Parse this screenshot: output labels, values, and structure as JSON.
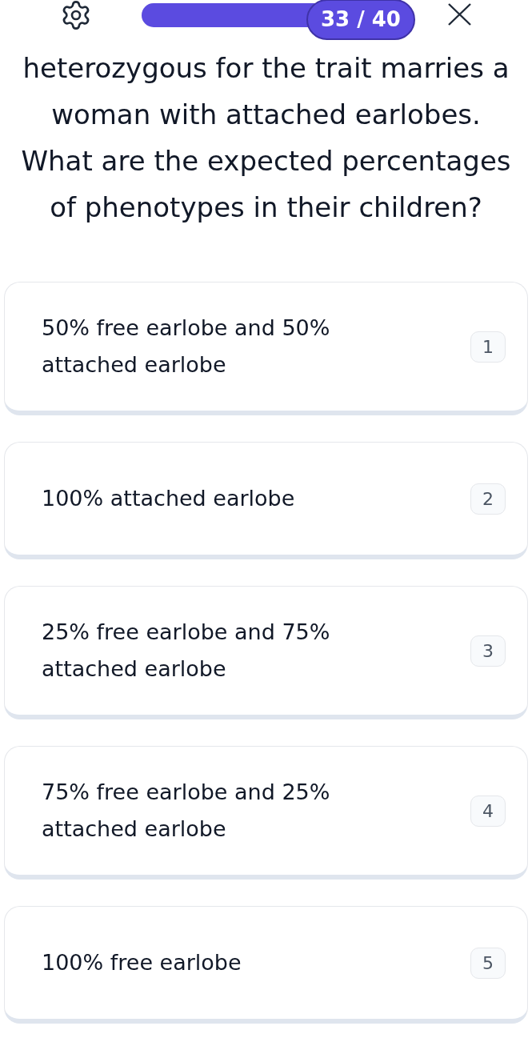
{
  "top_bar": {
    "progress": {
      "level": 0.825,
      "label": "33 / 40"
    }
  },
  "question": "heterozygous for the trait marries a woman with attached earlobes. What are the expected percentages of phenotypes in their children?",
  "options": [
    {
      "text": "50% free earlobe and 50% attached earlobe",
      "key": "1"
    },
    {
      "text": "100% attached earlobe",
      "key": "2"
    },
    {
      "text": "25% free earlobe and 75% attached earlobe",
      "key": "3"
    },
    {
      "text": "75% free earlobe and 25% attached earlobe",
      "key": "4"
    },
    {
      "text": "100% free earlobe",
      "key": "5"
    }
  ]
}
